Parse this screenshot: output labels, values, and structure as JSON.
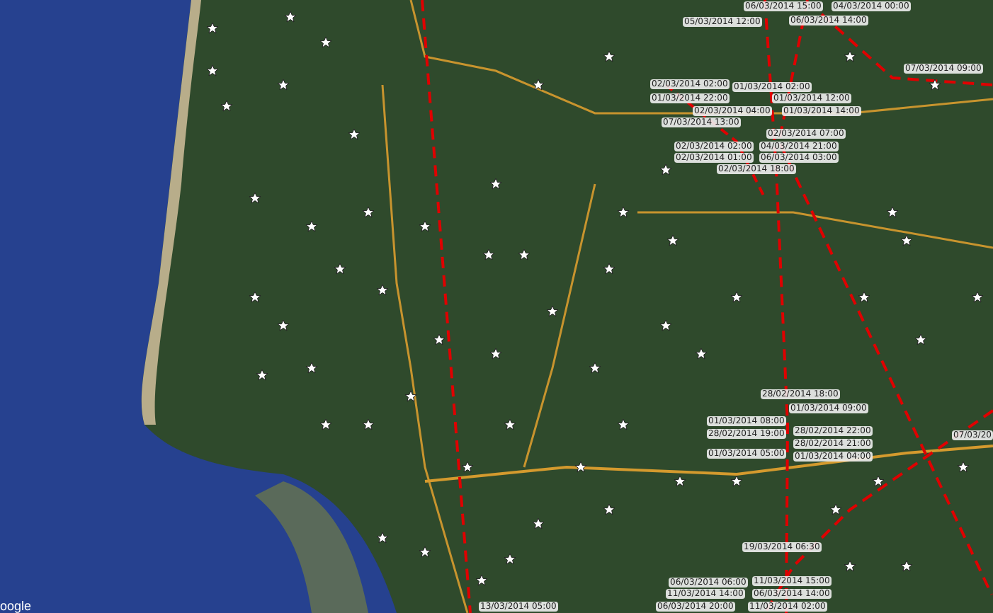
{
  "map": {
    "attribution": "oogle",
    "track_labels": [
      {
        "text": "06/03/2014 15:00"
      },
      {
        "text": "04/03/2014 00:00"
      },
      {
        "text": "05/03/2014 12:00"
      },
      {
        "text": "06/03/2014 14:00"
      },
      {
        "text": "07/03/2014 09:00"
      },
      {
        "text": "02/03/2014 02:00"
      },
      {
        "text": "01/03/2014 02:00"
      },
      {
        "text": "01/03/2014 22:00"
      },
      {
        "text": "01/03/2014 12:00"
      },
      {
        "text": "02/03/2014 04:00"
      },
      {
        "text": "01/03/2014 14:00"
      },
      {
        "text": "07/03/2014 13:00"
      },
      {
        "text": "02/03/2014 07:00"
      },
      {
        "text": "02/03/2014 02:00"
      },
      {
        "text": "04/03/2014 21:00"
      },
      {
        "text": "02/03/2014 01:00"
      },
      {
        "text": "06/03/2014 03:00"
      },
      {
        "text": "02/03/2014 18:00"
      },
      {
        "text": "28/02/2014 18:00"
      },
      {
        "text": "01/03/2014 09:00"
      },
      {
        "text": "01/03/2014 08:00"
      },
      {
        "text": "28/02/2014 19:00"
      },
      {
        "text": "28/02/2014 22:00"
      },
      {
        "text": "28/02/2014 21:00"
      },
      {
        "text": "01/03/2014 05:00"
      },
      {
        "text": "01/03/2014 04:00"
      },
      {
        "text": "07/03/20"
      },
      {
        "text": "19/03/2014 06:30"
      },
      {
        "text": "06/03/2014 06:00"
      },
      {
        "text": "11/03/2014 15:00"
      },
      {
        "text": "11/03/2014 14:00"
      },
      {
        "text": "06/03/2014 14:00"
      },
      {
        "text": "13/03/2014 05:00"
      },
      {
        "text": "06/03/2014 20:00"
      },
      {
        "text": "11/03/2014 02:00"
      }
    ]
  }
}
